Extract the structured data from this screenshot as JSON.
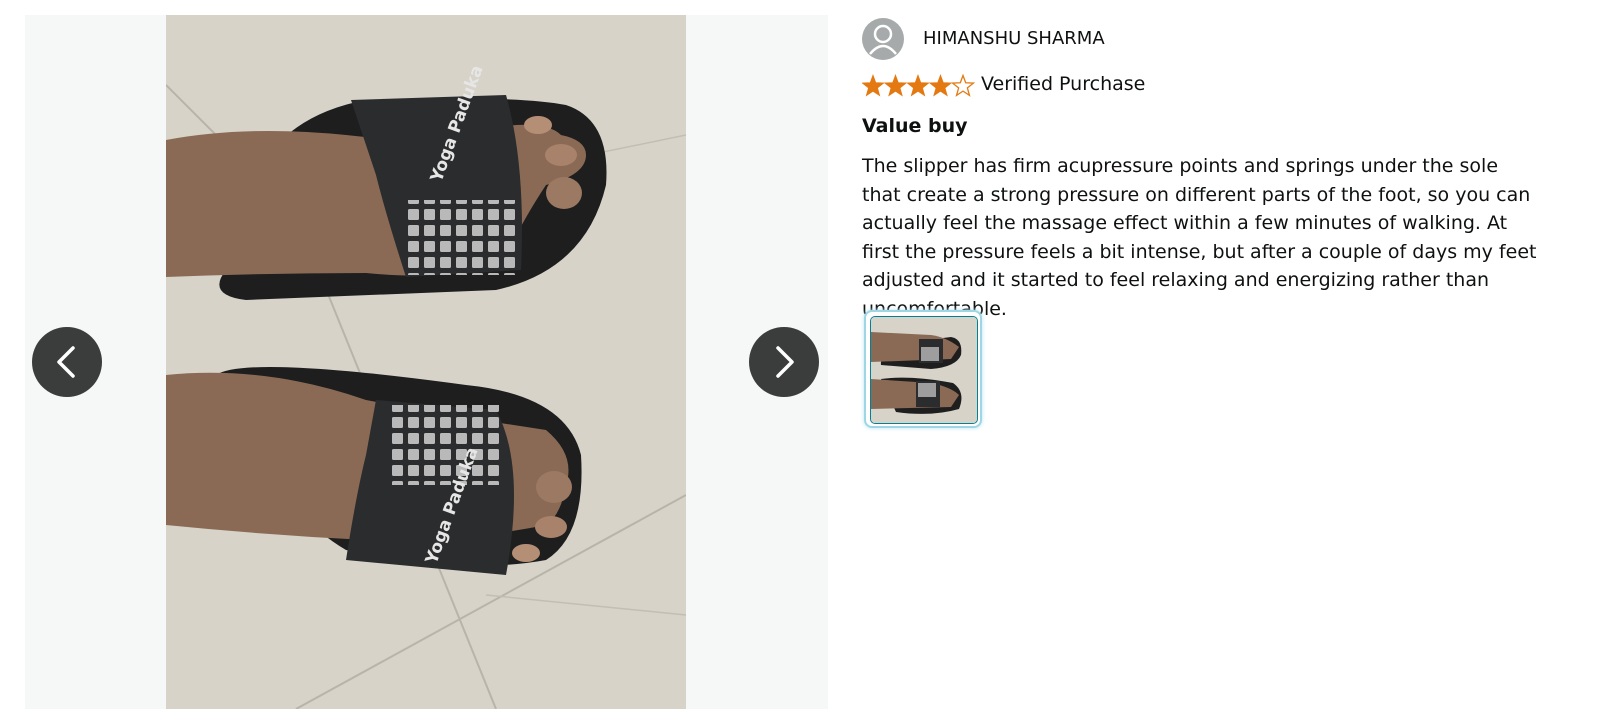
{
  "reviewer": {
    "name": "HIMANSHU SHARMA",
    "avatar_icon": "user-avatar-icon"
  },
  "rating": {
    "value": 4,
    "max": 5,
    "star_color": "#e47911"
  },
  "verified_label": "Verified Purchase",
  "review": {
    "title": "Value buy",
    "body": "The slipper has firm acupressure points and springs under the sole that create a strong pressure on different parts of the foot, so you can actually feel the massage effect within a few minutes of walking. At first the pressure feels a bit intense, but after a couple of days my feet adjusted and it started to feel relaxing and energizing rather than uncomfortable."
  },
  "gallery": {
    "prev_icon": "chevron-left-icon",
    "next_icon": "chevron-right-icon",
    "photo_logo_text": "Yoga Paduka",
    "thumbnail_count": 1,
    "selected_thumbnail": 1
  }
}
